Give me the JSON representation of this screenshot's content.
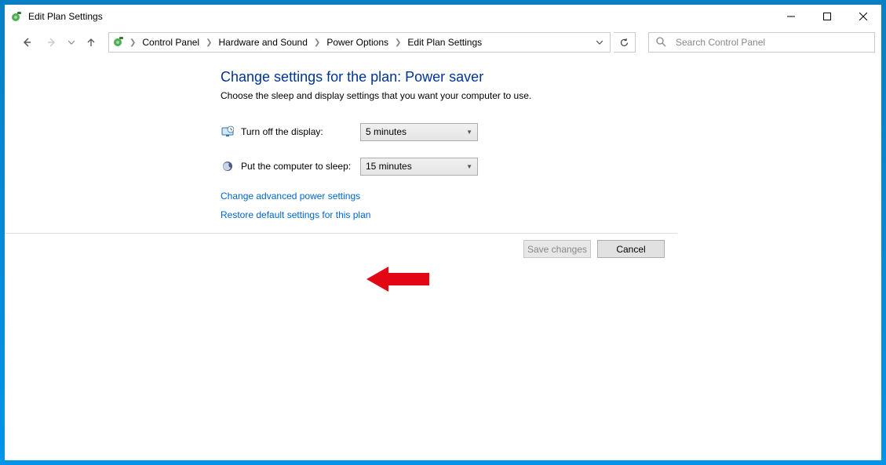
{
  "window": {
    "title": "Edit Plan Settings"
  },
  "breadcrumb": {
    "items": [
      "Control Panel",
      "Hardware and Sound",
      "Power Options",
      "Edit Plan Settings"
    ]
  },
  "search": {
    "placeholder": "Search Control Panel"
  },
  "page": {
    "heading": "Change settings for the plan: Power saver",
    "subheading": "Choose the sleep and display settings that you want your computer to use."
  },
  "settings": {
    "display_off": {
      "label": "Turn off the display:",
      "value": "5 minutes"
    },
    "sleep": {
      "label": "Put the computer to sleep:",
      "value": "15 minutes"
    }
  },
  "links": {
    "advanced": "Change advanced power settings",
    "restore": "Restore default settings for this plan"
  },
  "footer": {
    "save": "Save changes",
    "cancel": "Cancel"
  }
}
